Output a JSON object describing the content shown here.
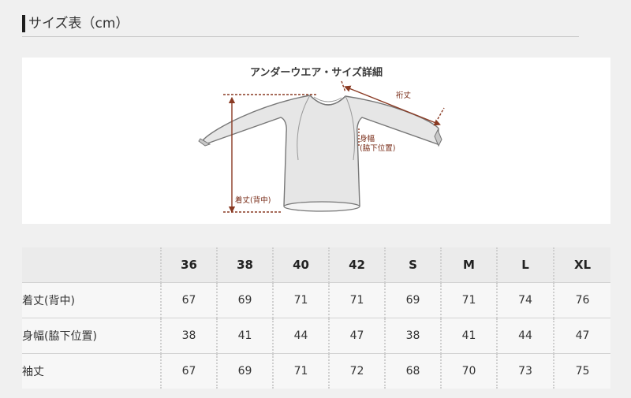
{
  "section": {
    "title": "サイズ表（cm）"
  },
  "diagram": {
    "title": "アンダーウエア・サイズ詳細",
    "labels": {
      "sleeve": "裄丈",
      "width": "身幅\n(脇下位置)",
      "length": "着丈(背中)"
    },
    "colors": {
      "garment_fill": "#e6e6e6",
      "garment_stroke": "#777777",
      "arrow": "#8a3a23"
    }
  },
  "table": {
    "sizes": [
      "36",
      "38",
      "40",
      "42",
      "S",
      "M",
      "L",
      "XL"
    ],
    "rows": [
      {
        "label": "着丈(背中)",
        "values": [
          "67",
          "69",
          "71",
          "71",
          "69",
          "71",
          "74",
          "76"
        ]
      },
      {
        "label": "身幅(脇下位置)",
        "values": [
          "38",
          "41",
          "44",
          "47",
          "38",
          "41",
          "44",
          "47"
        ]
      },
      {
        "label": "袖丈",
        "values": [
          "67",
          "69",
          "71",
          "72",
          "68",
          "70",
          "73",
          "75"
        ]
      }
    ]
  }
}
